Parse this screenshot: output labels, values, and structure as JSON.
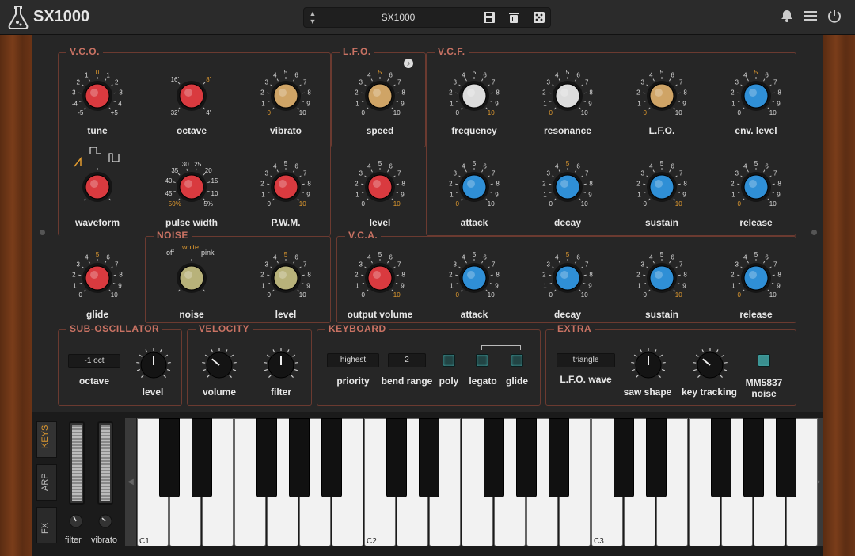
{
  "app": {
    "title": "SX1000",
    "preset": "SX1000"
  },
  "vco": {
    "title": "V.C.O.",
    "tune": "tune",
    "octave": "octave",
    "vibrato": "vibrato",
    "waveform": "waveform",
    "pulse_width": "pulse width",
    "pwm": "P.W.M.",
    "glide": "glide"
  },
  "lfo": {
    "title": "L.F.O.",
    "speed": "speed",
    "level": "level"
  },
  "vcf": {
    "title": "V.C.F.",
    "frequency": "frequency",
    "resonance": "resonance",
    "lfo": "L.F.O.",
    "env_level": "env. level",
    "attack": "attack",
    "decay": "decay",
    "sustain": "sustain",
    "release": "release"
  },
  "noise": {
    "title": "NOISE",
    "noise": "noise",
    "level": "level",
    "off": "off",
    "white": "white",
    "pink": "pink"
  },
  "vca": {
    "title": "V.C.A.",
    "output_volume": "output volume",
    "attack": "attack",
    "decay": "decay",
    "sustain": "sustain",
    "release": "release"
  },
  "sub": {
    "title": "SUB-OSCILLATOR",
    "octave_value": "-1 oct",
    "octave": "octave",
    "level": "level"
  },
  "velocity": {
    "title": "VELOCITY",
    "volume": "volume",
    "filter": "filter"
  },
  "keyboard": {
    "title": "KEYBOARD",
    "priority_value": "highest",
    "priority": "priority",
    "bend_value": "2",
    "bend_range": "bend range",
    "poly": "poly",
    "legato": "legato",
    "glide": "glide"
  },
  "extra": {
    "title": "EXTRA",
    "lfo_wave_value": "triangle",
    "lfo_wave": "L.F.O. wave",
    "saw_shape": "saw shape",
    "key_tracking": "key tracking",
    "mm_line1": "MM5837",
    "mm_line2": "noise"
  },
  "side": {
    "keys": "KEYS",
    "arp": "ARP",
    "fx": "FX",
    "filter": "filter",
    "vibrato": "vibrato"
  },
  "octaves": [
    "C1",
    "C2",
    "C3"
  ],
  "scale_010": [
    "0",
    "1",
    "2",
    "3",
    "4",
    "5",
    "6",
    "7",
    "8",
    "9",
    "10"
  ],
  "scale_tune": [
    "-5",
    "-4",
    "3",
    "2",
    "1",
    "0",
    "1",
    "2",
    "3",
    "4",
    "+5"
  ],
  "scale_oct": [
    "32'",
    "16'",
    "8'",
    "4'"
  ],
  "scale_pw": [
    "50%",
    "45",
    "40",
    "35",
    "30",
    "25",
    "20",
    "15",
    "10",
    "5%"
  ],
  "colors": {
    "red": "#d93a3f",
    "tan": "#cfa466",
    "white": "#dcdcdc",
    "blue": "#2f8fd6",
    "olive": "#b8b27a"
  }
}
